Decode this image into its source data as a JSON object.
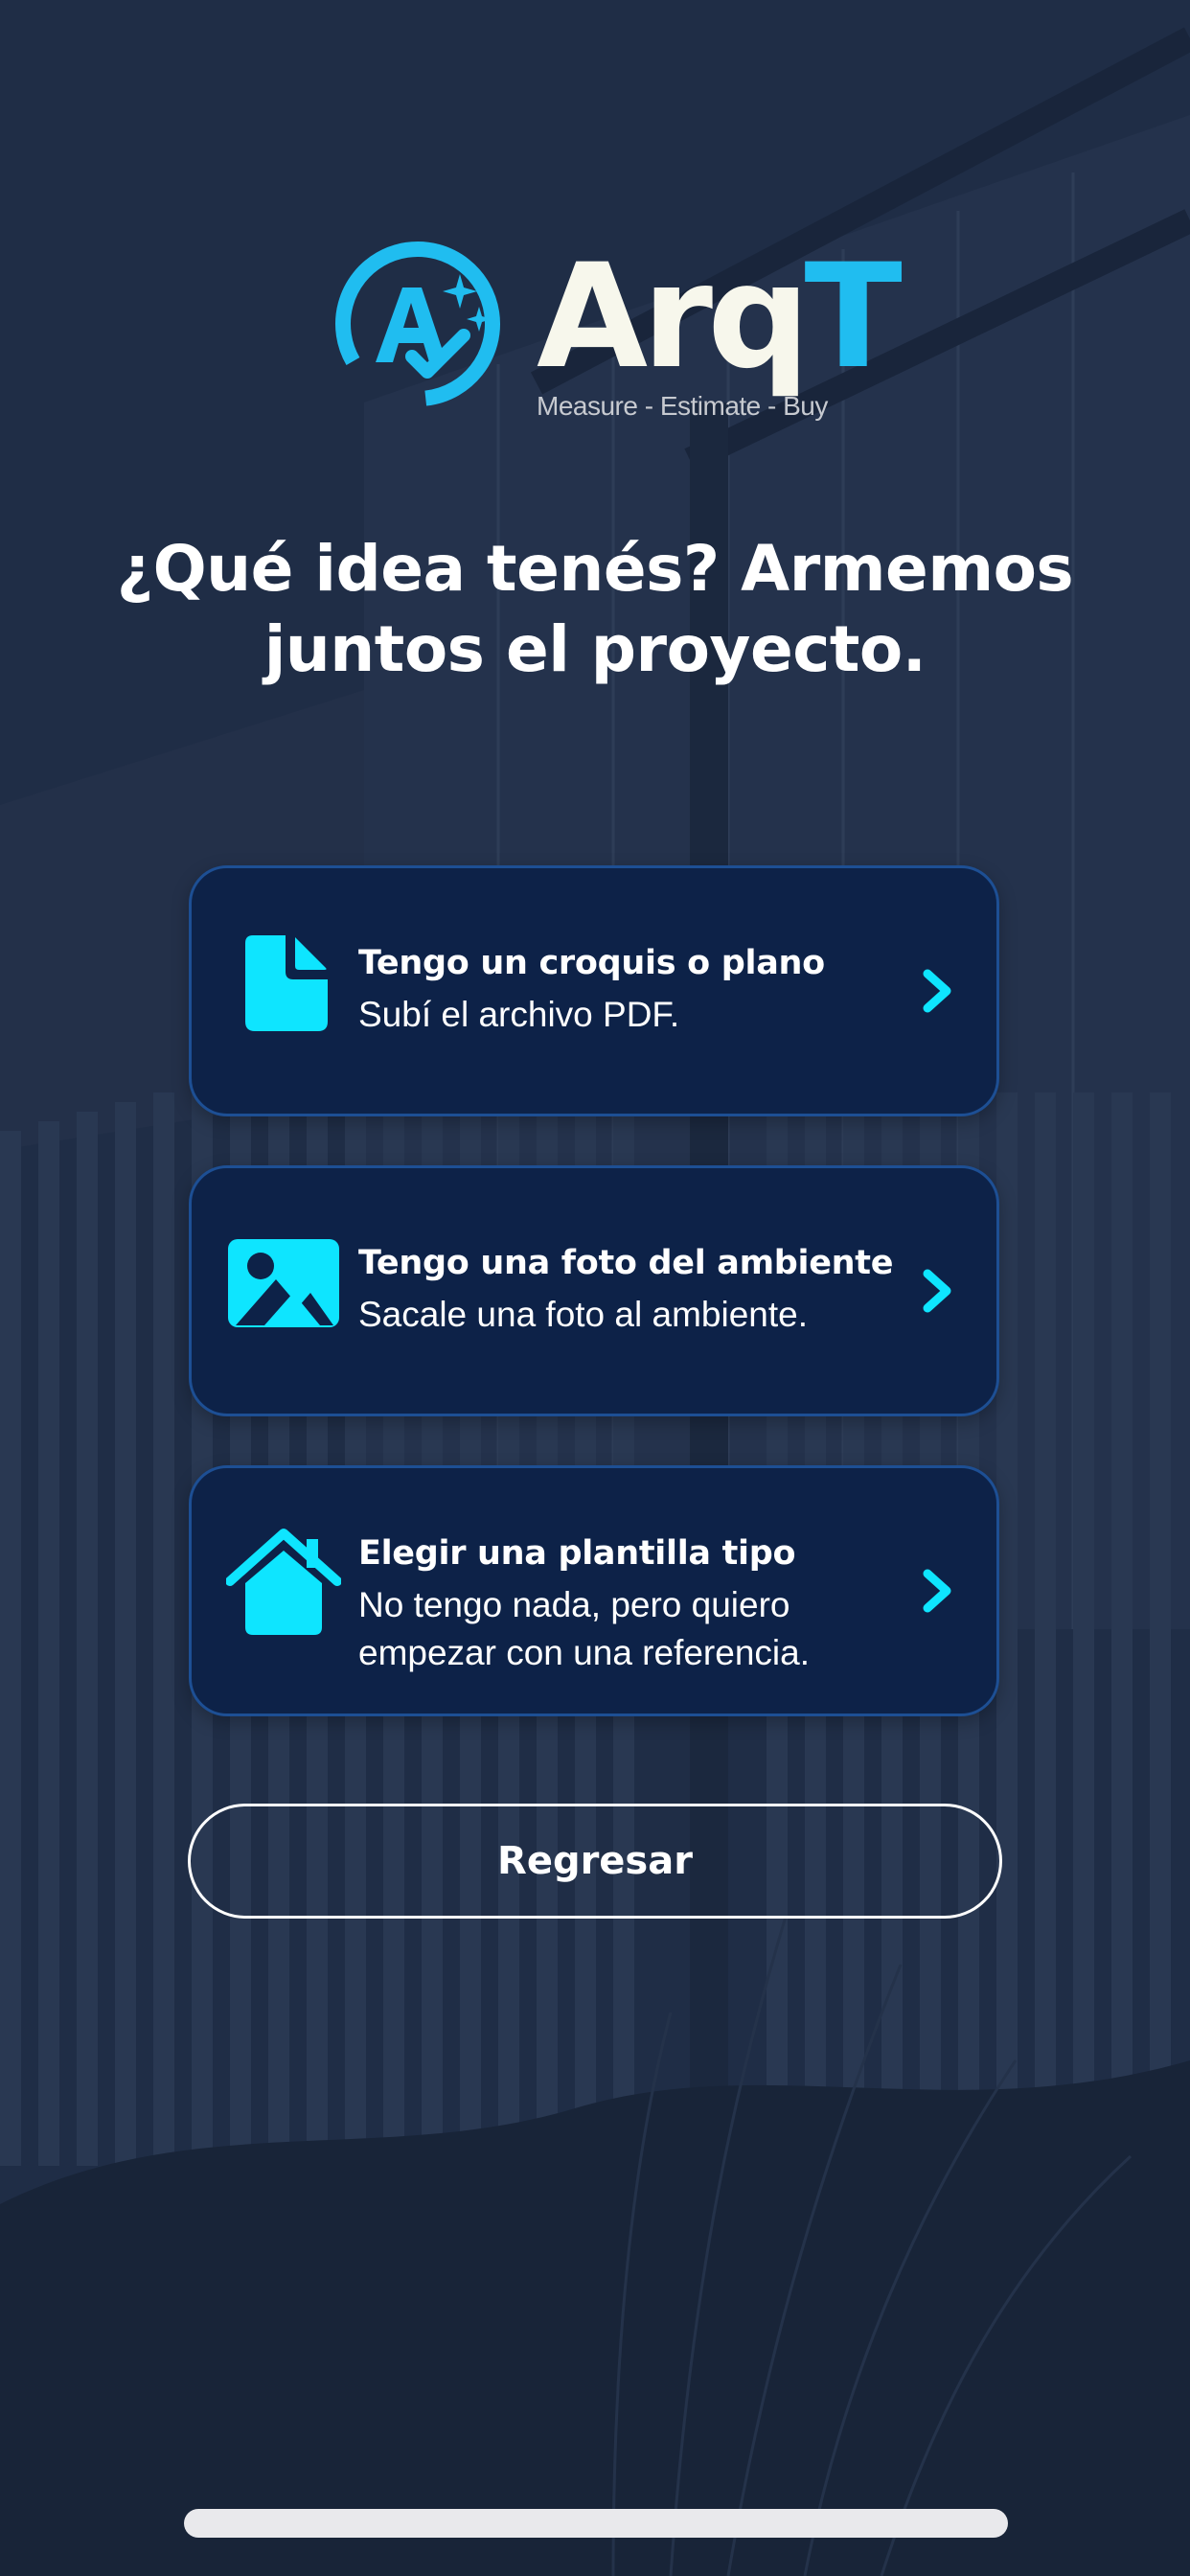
{
  "brand": {
    "name_main": "Arq",
    "name_accent": "T",
    "tagline": "Measure - Estimate - Buy",
    "accent_color": "#20bdf0"
  },
  "headline": "¿Qué idea tenés? Armemos juntos el proyecto.",
  "options": [
    {
      "title": "Tengo un croquis o plano",
      "subtitle": "Subí el archivo PDF.",
      "icon": "document-icon"
    },
    {
      "title": "Tengo una foto del ambiente",
      "subtitle": "Sacale una foto al ambiente.",
      "icon": "image-icon"
    },
    {
      "title": "Elegir una plantilla tipo",
      "subtitle": "No tengo nada, pero quiero empezar con una referencia.",
      "icon": "house-icon"
    }
  ],
  "back_button": {
    "label": "Regresar"
  },
  "colors": {
    "card_background": "#0d2248",
    "card_border": "#1d4f94",
    "icon_cyan": "#0ee5ff",
    "text": "#ffffff"
  }
}
